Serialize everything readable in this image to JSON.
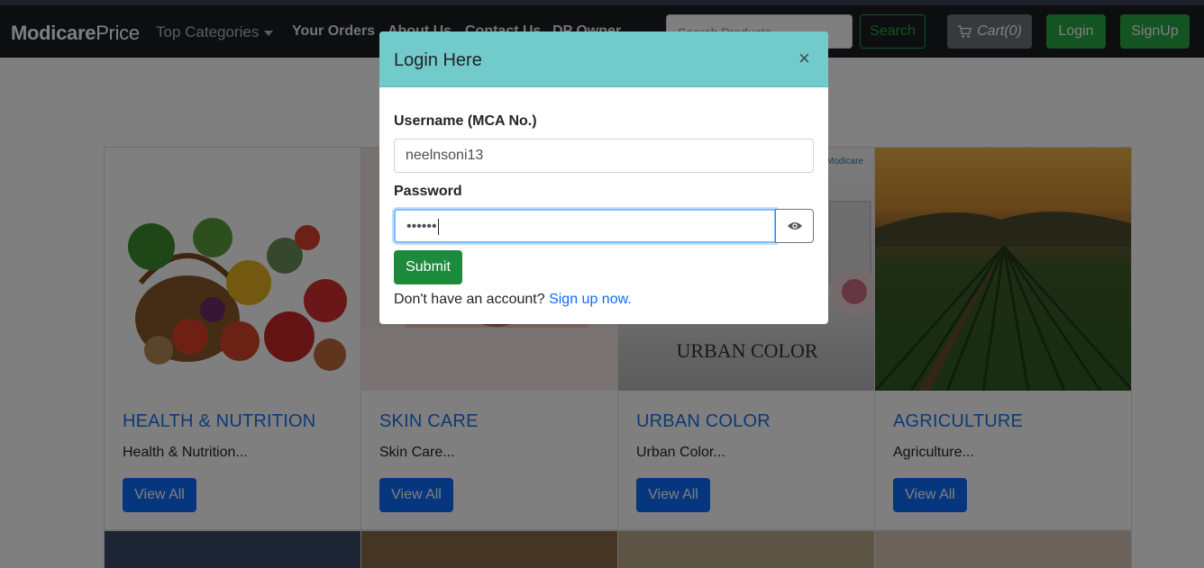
{
  "navbar": {
    "brand_part1": "Modicare",
    "brand_part2": "Price",
    "top_categories": "Top Categories",
    "your_orders": "Your Orders",
    "about_us": "About Us",
    "contact_us": "Contact Us",
    "dp_owner": "DP Owner",
    "search_placeholder": "Search Products",
    "search_button": "Search",
    "cart_label": "Cart(0)",
    "login_button": "Login",
    "signup_button": "SignUp"
  },
  "cards": [
    {
      "title": "HEALTH & NUTRITION",
      "text": "Health & Nutrition...",
      "button": "View All"
    },
    {
      "title": "SKIN CARE",
      "text": "Skin Care...",
      "button": "View All"
    },
    {
      "title": "URBAN COLOR",
      "text": "Urban Color...",
      "button": "View All",
      "image_text": "URBAN COLOR",
      "image_logo": "Modicare"
    },
    {
      "title": "AGRICULTURE",
      "text": "Agriculture...",
      "button": "View All"
    }
  ],
  "modal": {
    "title": "Login Here",
    "close_symbol": "×",
    "username_label": "Username (MCA No.)",
    "username_value": "neelnsoni13",
    "password_label": "Password",
    "password_masked": "••••••",
    "submit_button": "Submit",
    "signup_prompt": "Don't have an account?",
    "signup_link": "Sign up now."
  },
  "colors": {
    "primary_blue": "#0d6efd",
    "success_green": "#28a745",
    "modal_header": "#72cbcb",
    "navbar_bg": "#1b1d20"
  }
}
